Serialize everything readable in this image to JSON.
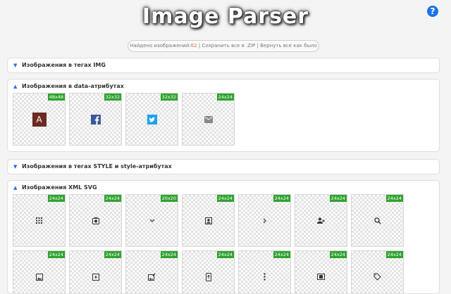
{
  "header": {
    "title": "Image Parser",
    "help_label": "?"
  },
  "stats": {
    "found_label": "Найдено изображений:",
    "found_count": "62",
    "separator": "|",
    "save_zip": "Сохранить все в .ZIP",
    "reset": "Вернуть все как было"
  },
  "sections": {
    "img": {
      "title": "Изображения в тегах IMG",
      "arrow": "▼",
      "expanded": false
    },
    "data_attr": {
      "title": "Изображения в data-атрибутах",
      "arrow": "▲",
      "expanded": true,
      "tiles": [
        {
          "size": "48x48",
          "icon": "avatar-letter",
          "letter": "A",
          "color": "#6b2a22"
        },
        {
          "size": "32x32",
          "icon": "facebook-icon",
          "letter": "f",
          "color": "#3b5998"
        },
        {
          "size": "32x32",
          "icon": "twitter-icon",
          "color": "#1da1f2"
        },
        {
          "size": "24x24",
          "icon": "mail-icon",
          "color": "#888888"
        }
      ]
    },
    "style": {
      "title": "Изображения в тегах STYLE и style-атрибутах",
      "arrow": "▼",
      "expanded": false
    },
    "svg": {
      "title": "Изображения XML SVG",
      "arrow": "▲",
      "expanded": true,
      "tiles": [
        {
          "size": "24x24",
          "icon": "apps-grid-icon"
        },
        {
          "size": "24x24",
          "icon": "camera-box-icon"
        },
        {
          "size": "20x20",
          "icon": "chevron-down-icon"
        },
        {
          "size": "24x24",
          "icon": "account-box-icon"
        },
        {
          "size": "24x24",
          "icon": "chevron-right-icon"
        },
        {
          "size": "24x24",
          "icon": "add-person-icon"
        },
        {
          "size": "24x24",
          "icon": "search-icon"
        },
        {
          "size": "24x24",
          "icon": "image-icon"
        },
        {
          "size": "24x24",
          "icon": "video-box-icon"
        },
        {
          "size": "24x24",
          "icon": "image-edit-icon"
        },
        {
          "size": "24x24",
          "icon": "phone-upload-icon"
        },
        {
          "size": "24x24",
          "icon": "more-vertical-icon"
        },
        {
          "size": "24x24",
          "icon": "id-card-icon"
        },
        {
          "size": "24x24",
          "icon": "label-icon"
        }
      ]
    }
  },
  "colors": {
    "accent": "#1a73e8",
    "badge": "#2fa32f",
    "count": "#e8734a",
    "background": "#f4f4f4"
  }
}
